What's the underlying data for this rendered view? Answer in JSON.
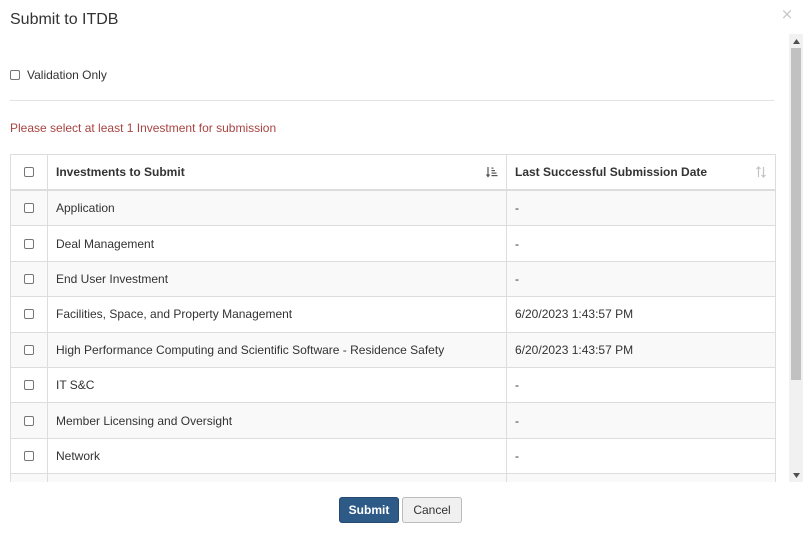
{
  "modal": {
    "title": "Submit to ITDB",
    "close_icon": "×"
  },
  "validation": {
    "label": "Validation Only",
    "checked": false
  },
  "error_message": "Please select at least 1 Investment for submission",
  "table": {
    "columns": [
      "Investments to Submit",
      "Last Successful Submission Date"
    ],
    "rows": [
      {
        "investment": "Application",
        "date": "-"
      },
      {
        "investment": "Deal Management",
        "date": "-"
      },
      {
        "investment": "End User Investment",
        "date": "-"
      },
      {
        "investment": "Facilities, Space, and Property Management",
        "date": "6/20/2023 1:43:57 PM"
      },
      {
        "investment": "High Performance Computing and Scientific Software - Residence Safety",
        "date": "6/20/2023 1:43:57 PM"
      },
      {
        "investment": "IT S&C",
        "date": "-"
      },
      {
        "investment": "Member Licensing and Oversight",
        "date": "-"
      },
      {
        "investment": "Network",
        "date": "-"
      },
      {
        "investment": "",
        "date": ""
      }
    ]
  },
  "footer": {
    "submit_label": "Submit",
    "cancel_label": "Cancel"
  },
  "colors": {
    "error": "#a94442",
    "primary_button": "#2e5a88"
  }
}
